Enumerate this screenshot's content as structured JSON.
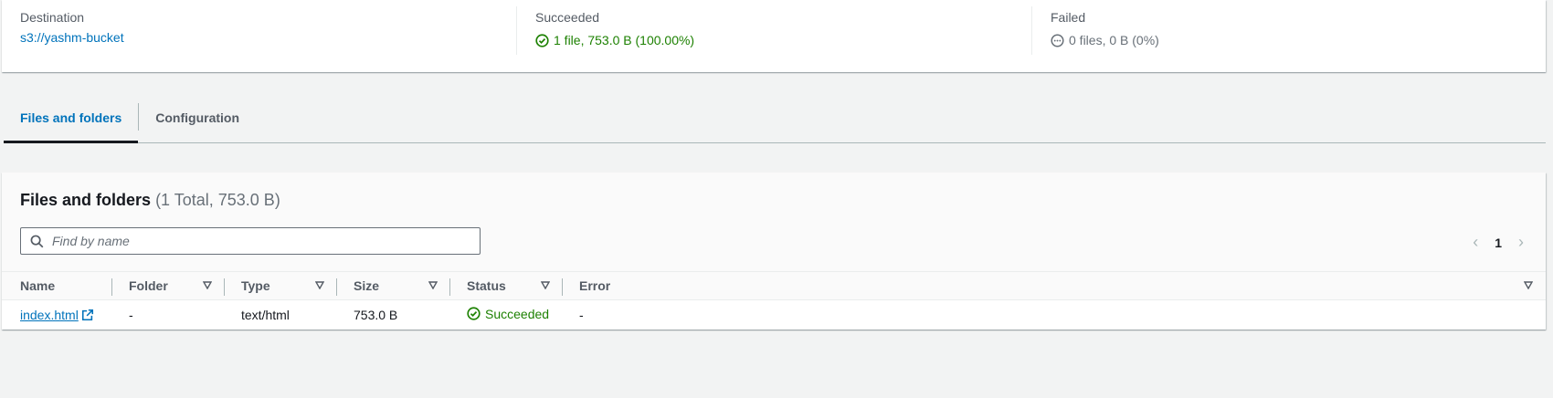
{
  "summary": {
    "destination": {
      "label": "Destination",
      "value": "s3://yashm-bucket"
    },
    "succeeded": {
      "label": "Succeeded",
      "value": "1 file, 753.0 B (100.00%)"
    },
    "failed": {
      "label": "Failed",
      "value": "0 files, 0 B (0%)"
    }
  },
  "tabs": [
    {
      "label": "Files and folders",
      "active": true
    },
    {
      "label": "Configuration",
      "active": false
    }
  ],
  "files_panel": {
    "title": "Files and folders",
    "count": "(1 Total, 753.0 B)",
    "search_placeholder": "Find by name",
    "current_page": "1",
    "columns": [
      "Name",
      "Folder",
      "Type",
      "Size",
      "Status",
      "Error"
    ],
    "rows": [
      {
        "name": "index.html",
        "folder": "-",
        "type": "text/html",
        "size": "753.0 B",
        "status": "Succeeded",
        "error": "-"
      }
    ]
  },
  "colors": {
    "link": "#0073bb",
    "success": "#1d8102",
    "muted": "#687078",
    "background": "#f2f3f3"
  }
}
